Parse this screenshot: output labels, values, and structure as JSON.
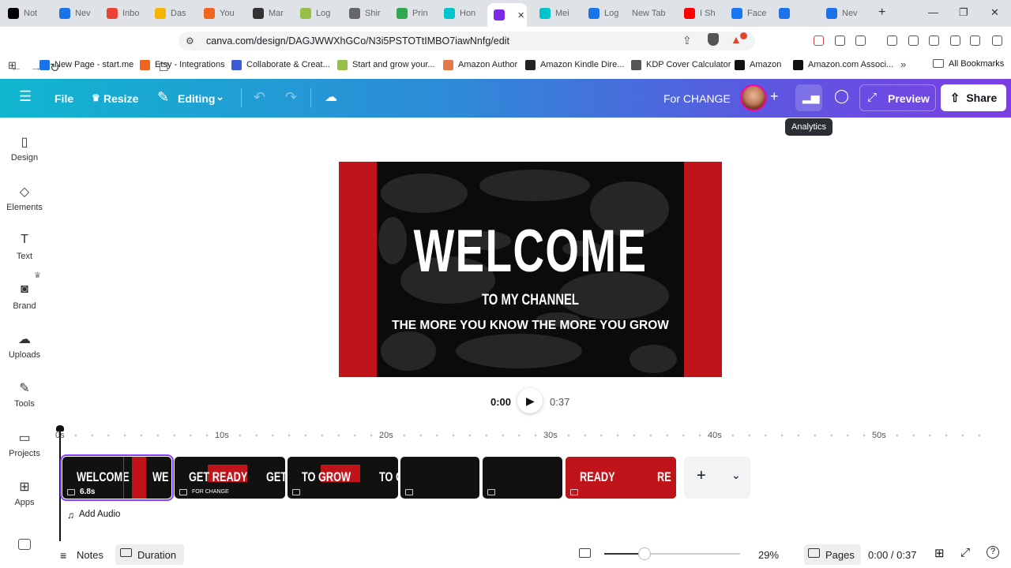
{
  "browser": {
    "tabs": [
      {
        "label": "Not",
        "icon": "x-icon",
        "color": "#000000"
      },
      {
        "label": "Nev",
        "icon": "doc-icon",
        "color": "#1a73e8"
      },
      {
        "label": "Inbo",
        "icon": "gmail-icon",
        "color": "#ea4335"
      },
      {
        "label": "Das",
        "icon": "chart-icon",
        "color": "#f4b400"
      },
      {
        "label": "You",
        "icon": "etsy-icon",
        "color": "#f1641e"
      },
      {
        "label": "Mar",
        "icon": "bank-icon",
        "color": "#333333"
      },
      {
        "label": "Log",
        "icon": "shopify-icon",
        "color": "#95bf47"
      },
      {
        "label": "Shir",
        "icon": "globe-icon",
        "color": "#666666"
      },
      {
        "label": "Prin",
        "icon": "printify-icon",
        "color": "#2fa84f"
      },
      {
        "label": "Hon",
        "icon": "canva-icon",
        "color": "#00c4cc"
      },
      {
        "label": "",
        "icon": "canva-video-icon",
        "color": "#7d2ae8"
      },
      {
        "label": "Mei",
        "icon": "canva-icon",
        "color": "#00c4cc"
      },
      {
        "label": "Log",
        "icon": "s-icon",
        "color": "#1a73e8"
      },
      {
        "label": "New Tab",
        "icon": "",
        "color": ""
      },
      {
        "label": "I Sh",
        "icon": "youtube-icon",
        "color": "#ff0000"
      },
      {
        "label": "Face",
        "icon": "facebook-icon",
        "color": "#1877f2"
      },
      {
        "label": "",
        "icon": "settings-icon",
        "color": "#1a73e8"
      },
      {
        "label": "Nev",
        "icon": "doc-icon",
        "color": "#1a73e8"
      }
    ],
    "url": "canva.com/design/DAGJWWXhGCo/N3i5PSTOTtIMBO7iawNnfg/edit",
    "bookmarks": [
      {
        "label": "New Page - start.me",
        "color": "#1a73e8"
      },
      {
        "label": "Etsy - Integrations",
        "color": "#f1641e"
      },
      {
        "label": "Collaborate & Creat...",
        "color": "#3b5bdb"
      },
      {
        "label": "Start and grow your...",
        "color": "#95bf47"
      },
      {
        "label": "Amazon Author",
        "color": "#e4784b"
      },
      {
        "label": "Amazon Kindle Dire...",
        "color": "#222222"
      },
      {
        "label": "KDP Cover Calculator",
        "color": "#555555"
      },
      {
        "label": "Amazon",
        "color": "#111111"
      },
      {
        "label": "Amazon.com Associ...",
        "color": "#111111"
      }
    ],
    "all_bookmarks": "All Bookmarks",
    "more_bookmarks": "»"
  },
  "canva": {
    "file": "File",
    "resize": "Resize",
    "editing": "Editing",
    "team": "For CHANGE",
    "preview": "Preview",
    "share": "Share",
    "tooltip": "Analytics"
  },
  "sidebar": [
    {
      "label": "Design",
      "icon": "design-icon"
    },
    {
      "label": "Elements",
      "icon": "elements-icon"
    },
    {
      "label": "Text",
      "icon": "text-icon"
    },
    {
      "label": "Brand",
      "icon": "brand-icon"
    },
    {
      "label": "Uploads",
      "icon": "uploads-icon"
    },
    {
      "label": "Tools",
      "icon": "tools-icon"
    },
    {
      "label": "Projects",
      "icon": "projects-icon"
    },
    {
      "label": "Apps",
      "icon": "apps-icon"
    }
  ],
  "slide": {
    "headline": "WELCOME",
    "sub": "TO MY CHANNEL",
    "tagline": "THE MORE YOU KNOW THE MORE YOU GROW"
  },
  "player": {
    "current": "0:00",
    "total": "0:37"
  },
  "timeline": {
    "ticks": [
      "0s",
      "10s",
      "20s",
      "30s",
      "40s",
      "50s"
    ],
    "clips": [
      {
        "label": "WELCOME",
        "tail": "WE",
        "duration": "6.8s"
      },
      {
        "label": "GET READY",
        "tail": "GET R",
        "caption": "FOR CHANGE"
      },
      {
        "label": "TO GROW",
        "tail": "TO G"
      },
      {
        "label": ""
      },
      {
        "label": ""
      },
      {
        "label": "READY",
        "tail": "RE"
      }
    ],
    "add_audio": "Add Audio"
  },
  "footer": {
    "notes": "Notes",
    "duration": "Duration",
    "zoom": "29%",
    "pages": "Pages",
    "time": "0:00 / 0:37"
  }
}
